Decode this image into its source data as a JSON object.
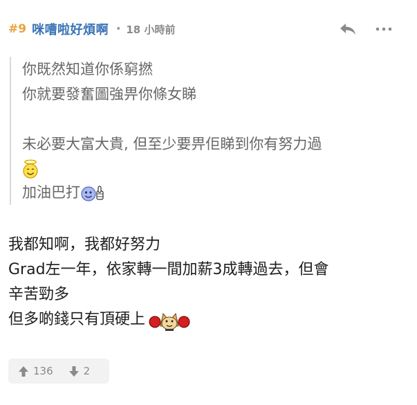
{
  "header": {
    "floor": "#9",
    "username": "咪嘈啦好煩啊",
    "separator": "•",
    "time": "18 小時前"
  },
  "quote": {
    "lines": [
      "你既然知道你係窮撚",
      "你就要發奮圖強畀你條女睇",
      "未必要大富大貴, 但至少要畀佢睇到你有努力過",
      "加油巴打"
    ],
    "emojis": [
      "angel-smiley-icon",
      "thumbs-up-smiley-icon"
    ]
  },
  "reply": {
    "lines": [
      "我都知啊，我都好努力",
      "Grad左一年，依家轉一間加薪3成轉過去，但會",
      "辛苦勁多",
      "但多啲錢只有頂硬上"
    ],
    "emojis": [
      "boxing-dog-icon"
    ]
  },
  "votes": {
    "up_count": "136",
    "down_count": "2"
  },
  "colors": {
    "floor": "#e8a33d",
    "username": "#3a73b5",
    "quote_text": "#666666",
    "muted": "#8a8a8a"
  }
}
